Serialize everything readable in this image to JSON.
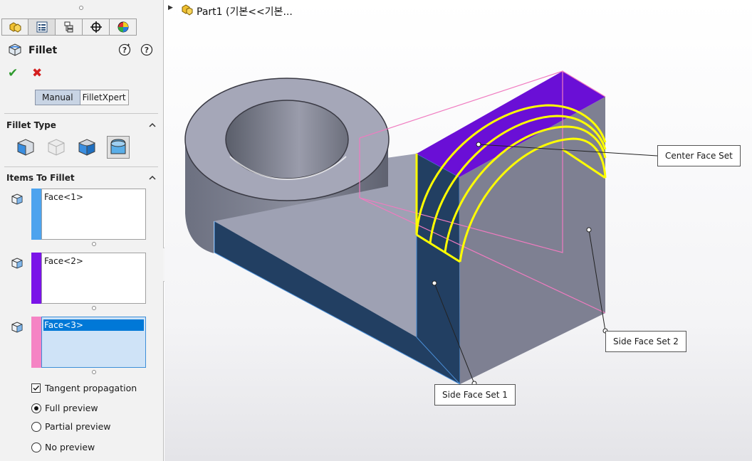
{
  "tabs": [
    {
      "name": "featuremanager-icon"
    },
    {
      "name": "propertymanager-icon"
    },
    {
      "name": "configurationmanager-icon"
    },
    {
      "name": "dimxpert-icon"
    },
    {
      "name": "display-manager-icon"
    }
  ],
  "feature": {
    "title": "Fillet"
  },
  "modes": {
    "manual": "Manual",
    "filletxpert": "FilletXpert"
  },
  "sections": {
    "fillet_type": "Fillet Type",
    "items_to_fillet": "Items To Fillet"
  },
  "faces": [
    {
      "label": "Face<1>",
      "color": "#4da3ee"
    },
    {
      "label": "Face<2>",
      "color": "#7a14e8"
    },
    {
      "label": "Face<3>",
      "color": "#f584c4"
    }
  ],
  "options": {
    "tangent": "Tangent propagation",
    "full": "Full preview",
    "partial": "Partial preview",
    "none": "No preview"
  },
  "tree": {
    "label": "Part1  (기본<<기본..."
  },
  "callouts": {
    "center": "Center Face Set",
    "side1": "Side Face Set 1",
    "side2": "Side Face Set 2"
  },
  "colors": {
    "accent": "#0078d7",
    "highlight": "#ffff00",
    "shaded": "#1f3d64"
  }
}
